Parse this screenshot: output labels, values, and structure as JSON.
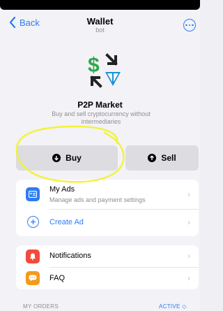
{
  "nav": {
    "back_label": "Back",
    "title": "Wallet",
    "subtitle": "bot"
  },
  "market": {
    "title": "P2P Market",
    "description": "Buy and sell cryptocurrency without intermediaries"
  },
  "actions": {
    "buy_label": "Buy",
    "sell_label": "Sell"
  },
  "menu1": {
    "my_ads_label": "My Ads",
    "my_ads_sub": "Manage ads and payment settings",
    "create_ad_label": "Create Ad"
  },
  "menu2": {
    "notifications_label": "Notifications",
    "faq_label": "FAQ"
  },
  "orders": {
    "section_label": "MY ORDERS",
    "filter_label": "ACTIVE ◇"
  },
  "colors": {
    "accent": "#2d7cf6",
    "logo_green": "#2ea84a",
    "logo_blue": "#1b8fd6",
    "notif_red": "#f24b3d",
    "faq_orange": "#f49a1b",
    "highlight_yellow": "#f3f23a"
  }
}
